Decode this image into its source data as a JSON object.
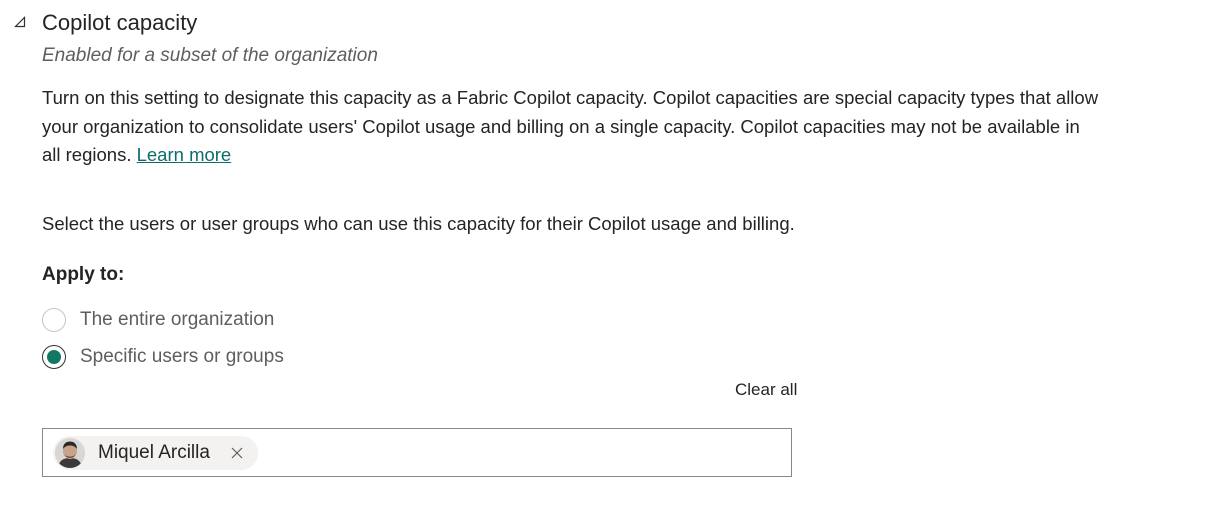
{
  "section": {
    "title": "Copilot capacity",
    "subtitle": "Enabled for a subset of the organization",
    "description_lines": [
      "Turn on this setting to designate this capacity as a Fabric Copilot capacity. Copilot capacities are special capacity types that allow",
      "your organization to consolidate users' Copilot usage and billing on a single capacity. Copilot capacities may not be available in",
      "all regions."
    ],
    "learn_more": "Learn more",
    "instruction": "Select the users or user groups who can use this capacity for their Copilot usage and billing.",
    "apply_label": "Apply to:",
    "options": [
      {
        "label": "The entire organization",
        "selected": false
      },
      {
        "label": "Specific users or groups",
        "selected": true
      }
    ],
    "clear_all": "Clear all",
    "selected_people": [
      {
        "name": "Miquel Arcilla",
        "icon": "person-avatar"
      }
    ]
  },
  "colors": {
    "accent": "#117865",
    "link": "#0f6c6a",
    "text": "#252423",
    "muted_text": "#605e5c",
    "border": "#8a8886",
    "chip_background": "#f3f2f1"
  },
  "icons": {
    "collapse": "collapse-triangle-icon",
    "remove": "close-icon"
  }
}
